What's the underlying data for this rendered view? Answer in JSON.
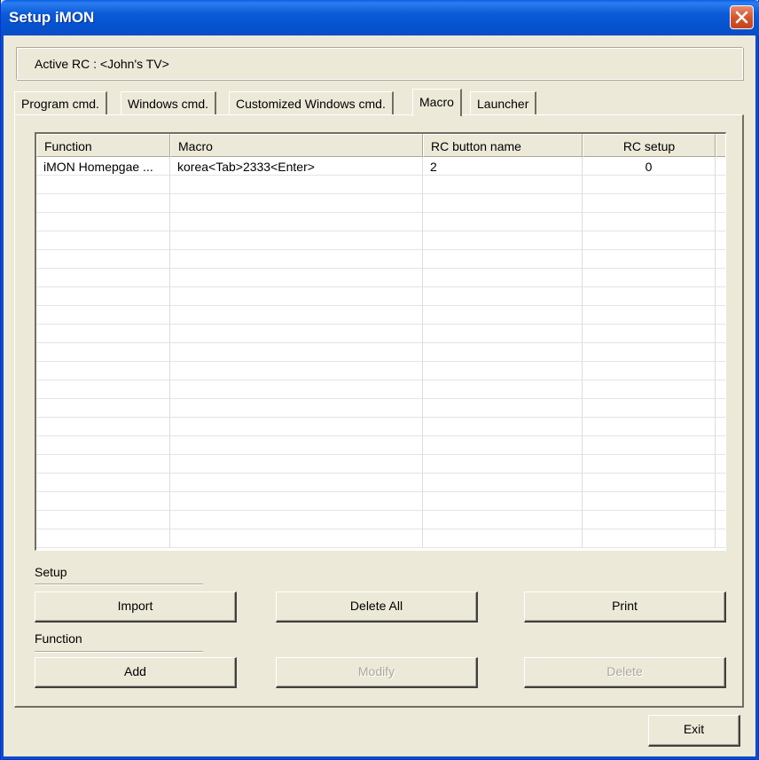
{
  "window": {
    "title": "Setup iMON",
    "close_label": "✕"
  },
  "active_rc": "Active RC : <John's TV>",
  "tabs": [
    {
      "label": "Program cmd.",
      "active": false
    },
    {
      "label": "Windows cmd.",
      "active": false
    },
    {
      "label": "Customized Windows cmd.",
      "active": false
    },
    {
      "label": "Macro",
      "active": true
    },
    {
      "label": "Launcher",
      "active": false
    }
  ],
  "table": {
    "columns": [
      "Function",
      "Macro",
      "RC button name",
      "RC setup"
    ],
    "rows": [
      {
        "function": "iMON Homepgae ...",
        "macro": "korea<Tab>2333<Enter>",
        "rc_button": "2",
        "rc_setup": "0"
      }
    ]
  },
  "setup_group": {
    "label": "Setup",
    "import": "Import",
    "delete_all": "Delete All",
    "print": "Print"
  },
  "function_group": {
    "label": "Function",
    "add": "Add",
    "modify": "Modify",
    "delete": "Delete"
  },
  "exit": "Exit"
}
